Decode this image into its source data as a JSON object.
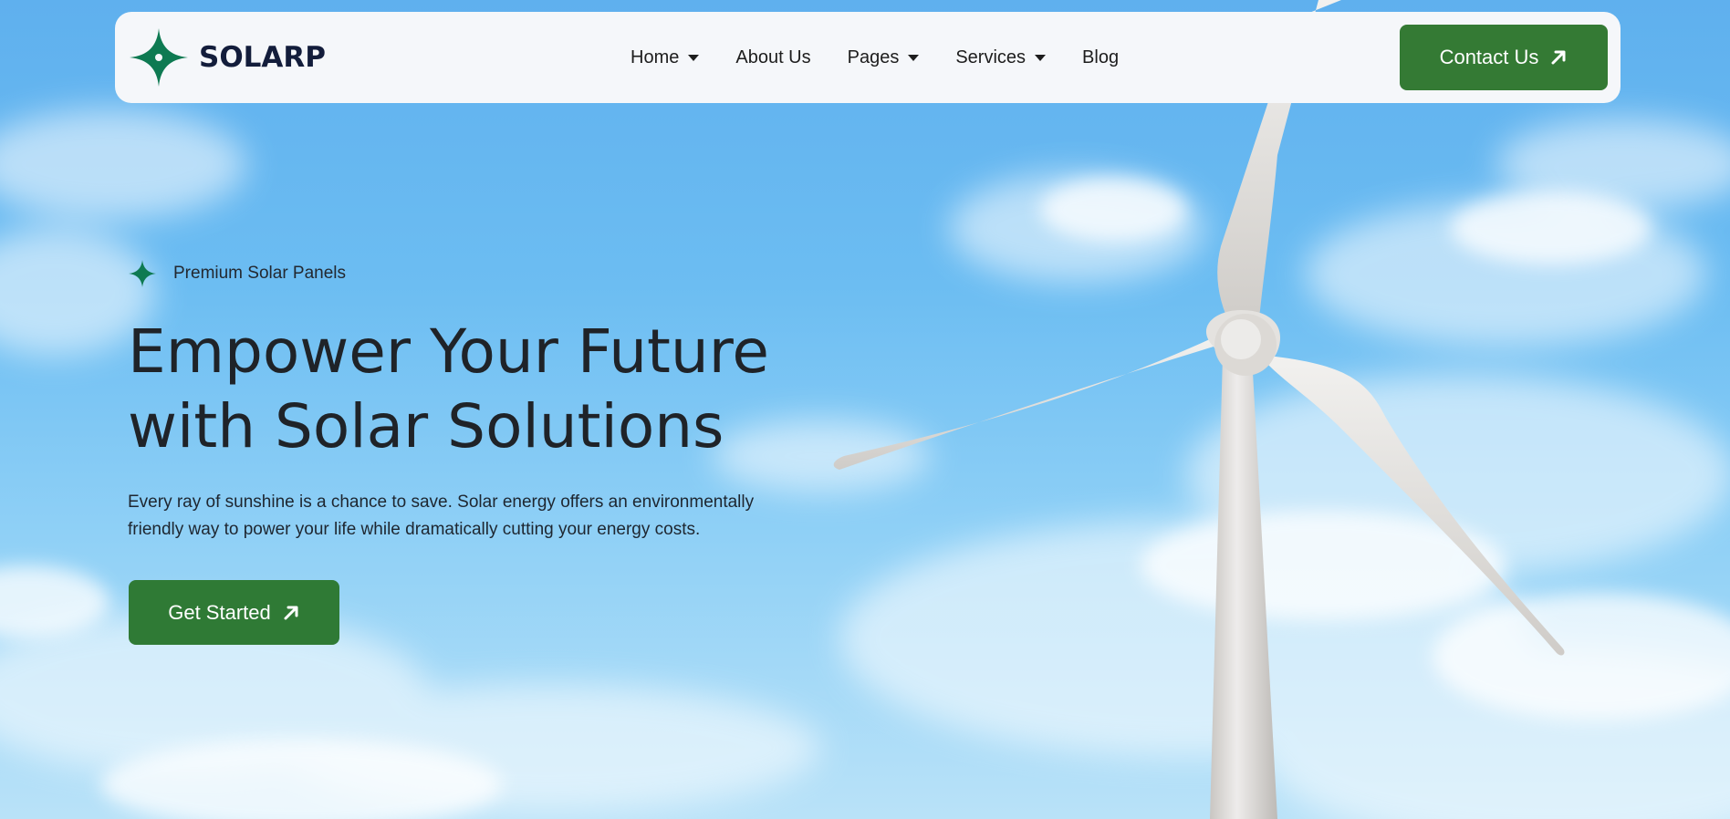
{
  "brand": {
    "name": "SOLARP",
    "logo_color": "#0e7a52"
  },
  "nav": {
    "items": [
      {
        "label": "Home",
        "has_dropdown": true
      },
      {
        "label": "About Us",
        "has_dropdown": false
      },
      {
        "label": "Pages",
        "has_dropdown": true
      },
      {
        "label": "Services",
        "has_dropdown": true
      },
      {
        "label": "Blog",
        "has_dropdown": false
      }
    ],
    "contact_label": "Contact Us"
  },
  "hero": {
    "eyebrow": "Premium Solar Panels",
    "title_line1": "Empower Your Future",
    "title_line2": "with Solar Solutions",
    "description": "Every ray of sunshine is a chance to save. Solar energy offers an environmentally friendly way to power your life while dramatically cutting your energy costs.",
    "cta_label": "Get Started"
  },
  "colors": {
    "accent_green": "#347a34",
    "text_dark": "#1f2328",
    "nav_bg": "#f5f7fa"
  },
  "icons": {
    "logo": "four-point-star-icon",
    "eyebrow": "four-point-star-icon",
    "button_arrow": "arrow-up-right-icon",
    "dropdown": "caret-down-icon"
  }
}
